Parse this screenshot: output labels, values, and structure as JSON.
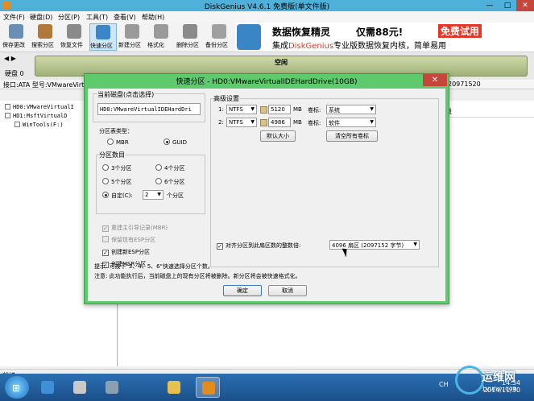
{
  "app": {
    "title": "DiskGenius V4.6.1 免费版(单文件版)",
    "controls": {
      "minimize": "—",
      "maximize": "□",
      "close": "✕"
    }
  },
  "menu": [
    {
      "label": "文件(F)"
    },
    {
      "label": "硬盘(D)"
    },
    {
      "label": "分区(P)"
    },
    {
      "label": "工具(T)"
    },
    {
      "label": "查看(V)"
    },
    {
      "label": "帮助(H)"
    }
  ],
  "toolbar": [
    {
      "label": "保存更改",
      "icon": "save-icon",
      "color": "#6a8fb5"
    },
    {
      "label": "搜索分区",
      "icon": "search-icon",
      "color": "#b07a3a"
    },
    {
      "label": "恢复文件",
      "icon": "recover-icon",
      "color": "#8a8a8a"
    },
    {
      "label": "快速分区",
      "icon": "quick-partition-icon",
      "color": "#3a86c8"
    },
    {
      "label": "新建分区",
      "icon": "new-partition-icon",
      "color": "#9a9a9a"
    },
    {
      "label": "格式化",
      "icon": "format-icon",
      "color": "#9a9a9a"
    },
    {
      "label": "删除分区",
      "icon": "delete-partition-icon",
      "color": "#8a8a8a"
    },
    {
      "label": "备份分区",
      "icon": "backup-icon",
      "color": "#a0a0a0"
    }
  ],
  "ad": {
    "headline": "数据恢复精灵",
    "price": "仅需88元!",
    "trial": "免费试用",
    "line2_pre": "集成",
    "line2_brand": "DiskGenius",
    "line2_post": "专业版数据恢复内核，简单易用"
  },
  "diskbar": {
    "arrows": "◀ ▶",
    "disk_label": "硬盘 0",
    "free_label": "空闲"
  },
  "infobar": {
    "left": "接口:ATA  型号:VMwareVirtu",
    "right": "20971520"
  },
  "tree": [
    {
      "label": "HD0:VMwareVirtualI"
    },
    {
      "label": "HD1:MsftVirtualD"
    },
    {
      "label": "WinTools(F:)"
    }
  ],
  "right_pane": {
    "column_size": "容量"
  },
  "status": "就绪",
  "dialog": {
    "title": "快速分区 - HD0:VMwareVirtualIDEHardDrive(10GB)",
    "close": "✕",
    "current_disk": {
      "title": "当前磁盘(点击选择)",
      "value": "HD0:VMwareVirtualIDEHardDri"
    },
    "partition_table": {
      "title": "分区表类型：",
      "options": [
        {
          "label": "MBR",
          "selected": false
        },
        {
          "label": "GUID",
          "selected": true
        }
      ]
    },
    "partition_count": {
      "title": "分区数目",
      "options": [
        {
          "label": "3个分区",
          "selected": false
        },
        {
          "label": "4个分区",
          "selected": false
        },
        {
          "label": "5个分区",
          "selected": false
        },
        {
          "label": "6个分区",
          "selected": false
        }
      ],
      "custom_label": "自定(C):",
      "custom_value": "2",
      "custom_suffix": "个分区"
    },
    "options": [
      {
        "label": "重建主引导记录(MBR)",
        "checked": true,
        "disabled": true
      },
      {
        "label": "保留现有ESP分区",
        "checked": false,
        "disabled": true
      },
      {
        "label": "创建新ESP分区",
        "checked": true,
        "disabled": false
      },
      {
        "label": "创建MSR分区",
        "checked": true,
        "disabled": false
      }
    ],
    "advanced": {
      "title": "高级设置",
      "rows": [
        {
          "index": "1:",
          "fs": "NTFS",
          "size": "5120",
          "unit": "MB",
          "vol_label": "卷标:",
          "vol_value": "系统"
        },
        {
          "index": "2:",
          "fs": "NTFS",
          "size": "4986",
          "unit": "MB",
          "vol_label": "卷标:",
          "vol_value": "软件"
        }
      ],
      "default_size_button": "默认大小",
      "clear_labels_button": "清空所有卷标"
    },
    "align": {
      "label": "对齐分区到此扇区数的整数倍:",
      "checked": true,
      "value": "4096 扇区 (2097152 字节)"
    },
    "hint": "提示: 可按下\"3、4、5、6\"快速选择分区个数。",
    "note": "注意: 此功能执行后，当前磁盘上的现有分区将被删除。新分区将会被快速格式化。",
    "ok_button": "确定",
    "cancel_button": "取消"
  },
  "taskbar": {
    "start": "⊞",
    "items": [
      {
        "icon": "ie-icon",
        "color": "#3d8fd6"
      },
      {
        "icon": "server-manager-icon",
        "color": "#c9c9c9"
      },
      {
        "icon": "device-icon",
        "color": "#8aa0b0"
      },
      {
        "icon": "explorer-icon",
        "color": "#e8c050"
      },
      {
        "icon": "diskgenius-icon",
        "color": "#e38b1e"
      }
    ],
    "tray": "CH",
    "time": "14:34",
    "date": "2014/11/30"
  },
  "watermark": {
    "name": "运维网",
    "url": "iyunv.com"
  }
}
